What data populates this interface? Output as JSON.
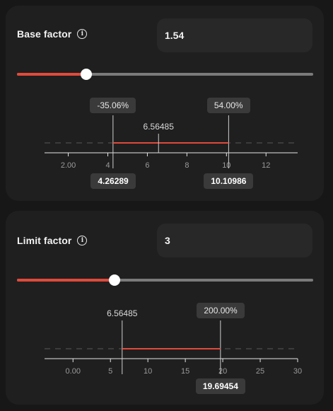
{
  "base": {
    "label": "Base factor",
    "icon": "info-icon",
    "value": "1.54",
    "slider_fraction": 0.235,
    "pct_low": "-35.06%",
    "pct_high": "54.00%",
    "center_value": "6.56485",
    "low_value": "4.26289",
    "high_value": "10.10986",
    "axis": {
      "min": 0.8,
      "max": 13.6,
      "ticks": [
        2,
        4,
        6,
        8,
        10,
        12
      ],
      "tick_labels": [
        "2.00",
        "4",
        "6",
        "8",
        "10",
        "12"
      ],
      "range_low": 4.26289,
      "range_high": 10.10986,
      "center": 6.56485
    }
  },
  "limit": {
    "label": "Limit factor",
    "icon": "info-icon",
    "value": "3",
    "slider_fraction": 0.33,
    "center_value": "6.56485",
    "pct_high": "200.00%",
    "high_value": "19.69454",
    "axis": {
      "min": -3.8,
      "max": 30,
      "ticks": [
        0,
        5,
        10,
        15,
        20,
        25,
        30
      ],
      "tick_labels": [
        "0.00",
        "5",
        "10",
        "15",
        "20",
        "25",
        "30"
      ],
      "range_low": 6.56485,
      "range_high": 19.69454,
      "center": 6.56485
    }
  },
  "colors": {
    "accent": "#e04a3b",
    "track": "#7a7a7a",
    "panel": "#1f1f1f",
    "background": "#171717"
  }
}
